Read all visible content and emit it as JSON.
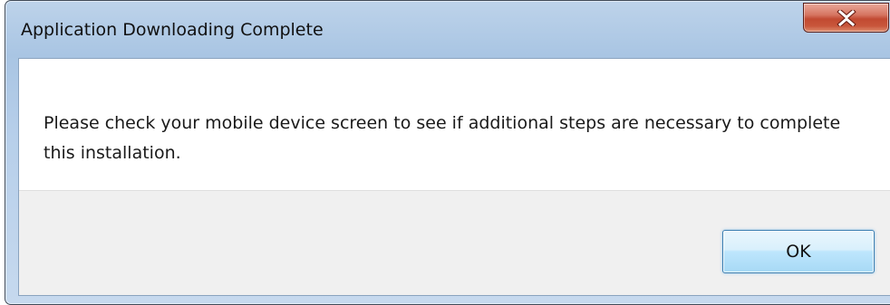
{
  "dialog": {
    "title": "Application Downloading Complete",
    "message": "Please check your mobile device screen to see if additional steps are necessary to complete this installation.",
    "ok_label": "OK",
    "close_icon": "close-icon"
  },
  "colors": {
    "frame_top": "#bdd3ea",
    "frame_bottom": "#c6d9ee",
    "close_button": "#c24a31",
    "client_background": "#ffffff",
    "button_bar_background": "#f0f0f0",
    "ok_button_border": "#3c7fb1"
  }
}
